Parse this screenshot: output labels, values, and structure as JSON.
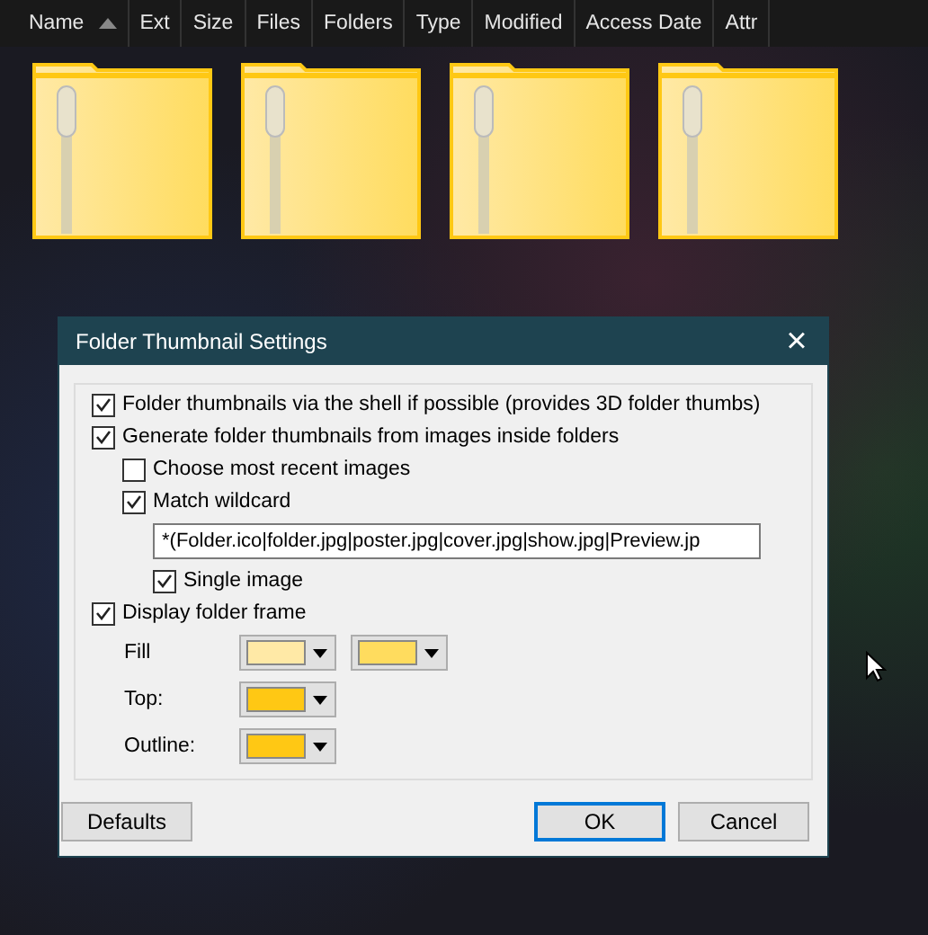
{
  "columns": [
    {
      "label": "Name",
      "sorted": true
    },
    {
      "label": "Ext",
      "sorted": false
    },
    {
      "label": "Size",
      "sorted": false
    },
    {
      "label": "Files",
      "sorted": false
    },
    {
      "label": "Folders",
      "sorted": false
    },
    {
      "label": "Type",
      "sorted": false
    },
    {
      "label": "Modified",
      "sorted": false
    },
    {
      "label": "Access Date",
      "sorted": false
    },
    {
      "label": "Attr",
      "sorted": false
    }
  ],
  "folders": [
    {
      "kind": "zip"
    },
    {
      "kind": "zip"
    },
    {
      "kind": "zip"
    },
    {
      "kind": "zip"
    }
  ],
  "dialog": {
    "title": "Folder Thumbnail Settings",
    "close": "×",
    "options": [
      {
        "label": "Folder thumbnails via the shell if possible (provides 3D folder thumbs)",
        "checked": true
      },
      {
        "label": "Generate folder thumbnails from images inside folders",
        "checked": true,
        "children": [
          {
            "label": "Choose most recent images",
            "checked": false
          },
          {
            "label": "Match wildcard",
            "checked": true,
            "value": "*(Folder.ico|folder.jpg|poster.jpg|cover.jpg|show.jpg|Preview.jp",
            "children": [
              {
                "label": "Single image",
                "checked": true
              }
            ]
          }
        ]
      },
      {
        "label": "Display folder frame",
        "checked": true
      }
    ],
    "colors": [
      {
        "label": "Fill",
        "swatches": [
          {
            "color": "#ffe9a6"
          },
          {
            "color": "#ffdc5e"
          }
        ]
      },
      {
        "label": "Top:",
        "swatches": [
          {
            "color": "#ffc814"
          }
        ]
      },
      {
        "label": "Outline:",
        "swatches": [
          {
            "color": "#ffc814"
          }
        ]
      }
    ],
    "buttons": [
      {
        "label": "Defaults",
        "default": false
      },
      {
        "label": "OK",
        "default": true
      },
      {
        "label": "Cancel",
        "default": false
      }
    ]
  }
}
